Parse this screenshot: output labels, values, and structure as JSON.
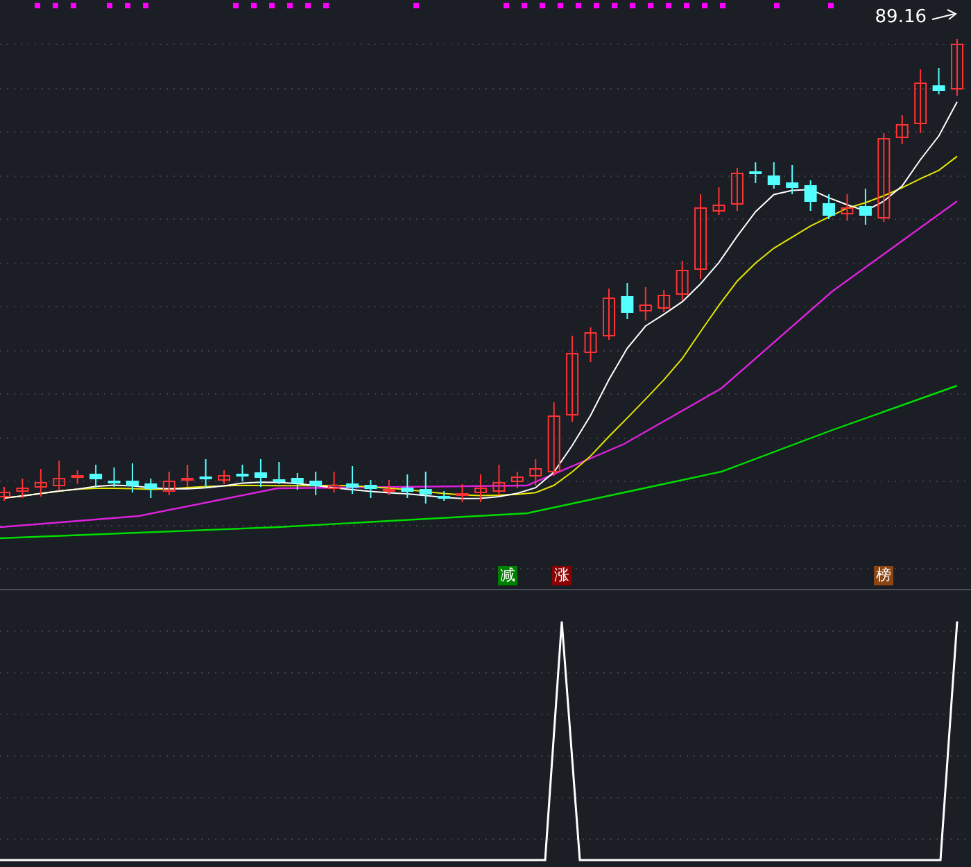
{
  "price_label": {
    "text": "89.16"
  },
  "signals": [
    {
      "text": "减",
      "color": "#008000"
    },
    {
      "text": "涨",
      "color": "#8b0000"
    },
    {
      "text": "榜",
      "color": "#8b4513"
    }
  ]
}
